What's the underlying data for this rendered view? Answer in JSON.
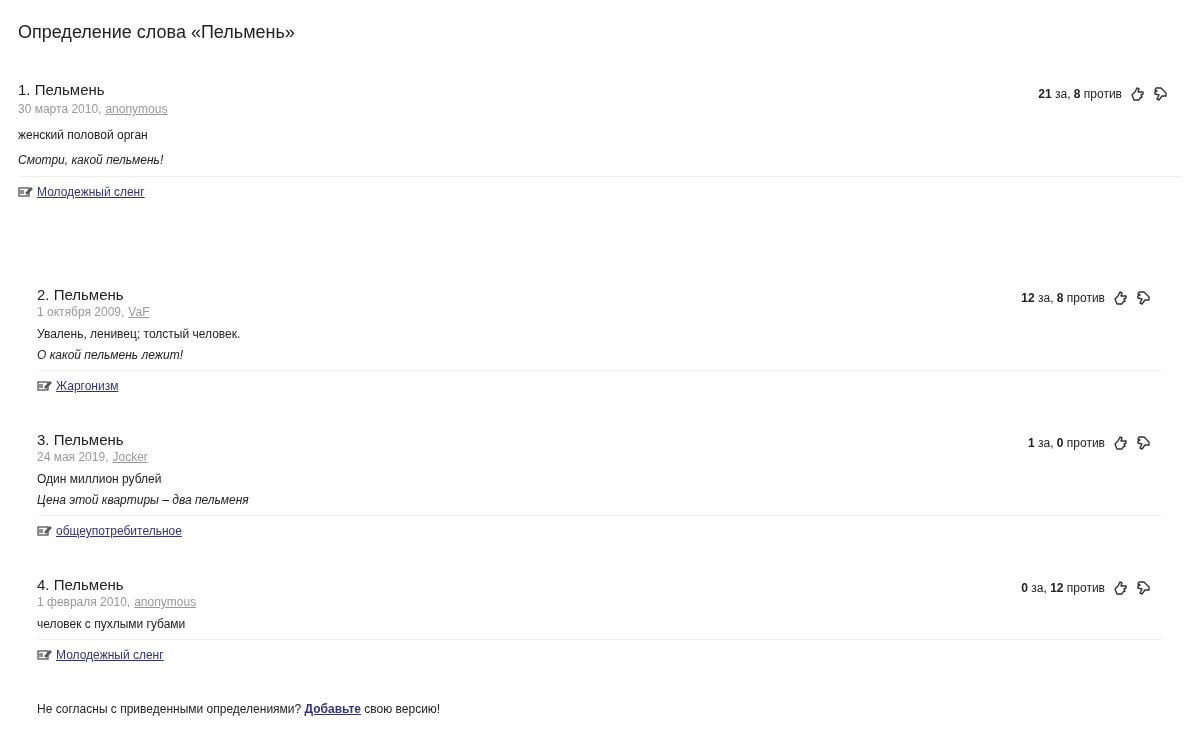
{
  "title": "Определение слова «Пельмень»",
  "entries": [
    {
      "heading": "1. Пельмень",
      "date": "30 марта 2010,",
      "author": "anonymous",
      "votes": "**21** за, **8** против",
      "definition": "женский половой орган",
      "example": "Смотри, какой пельмень!",
      "tag": "Молодежный сленг"
    },
    {
      "heading": "2. Пельмень",
      "date": "1 октября 2009,",
      "author": "VaF",
      "votes": "**12** за, **8** против",
      "definition": "Увалень, ленивец; толстый человек.",
      "example": "О какой пельмень лежит!",
      "tag": "Жаргонизм"
    },
    {
      "heading": "3. Пельмень",
      "date": "24 мая 2019,",
      "author": "Jocker",
      "votes": "**1** за, **0** против",
      "definition": "Один миллион рублей",
      "example": "Цена этой квартиры – два пельменя",
      "tag": "общеупотребительное"
    },
    {
      "heading": "4. Пельмень",
      "date": "1 февраля 2010,",
      "author": "anonymous",
      "votes": "**0** за, **12** против",
      "definition": "человек с пухлыми губами",
      "tag": "Молодежный сленг"
    }
  ],
  "footer": {
    "before": "Не согласны с приведенными определениями?",
    "link": "Добавьте",
    "after": "свою версию!"
  }
}
